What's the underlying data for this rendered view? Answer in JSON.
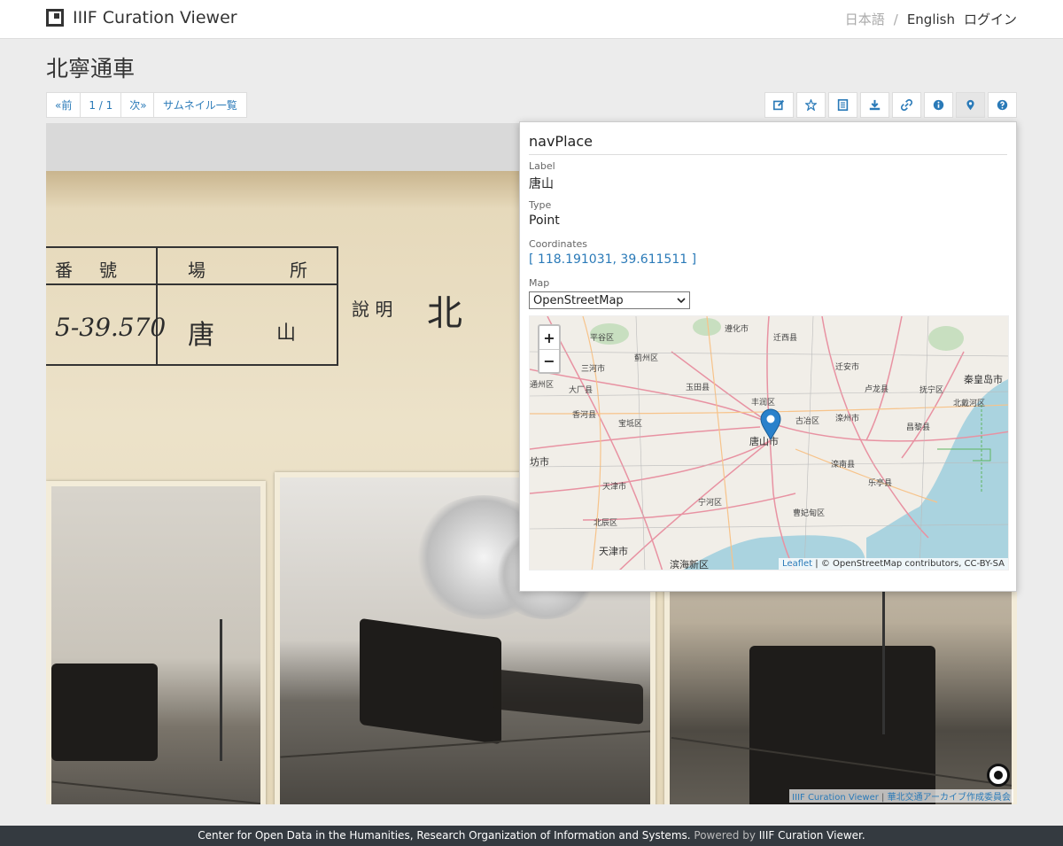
{
  "app": {
    "brand": "IIIF Curation Viewer",
    "lang_ja": "日本語",
    "lang_sep": "/",
    "lang_en": "English",
    "login": "ログイン"
  },
  "page": {
    "title": "北寧通車"
  },
  "pager": {
    "prev": "«前",
    "position": "1 / 1",
    "next": "次»",
    "thumbnails": "サムネイル一覧"
  },
  "toolbar": {
    "icons": [
      "edit-icon",
      "star-icon",
      "list-icon",
      "download-icon",
      "link-icon",
      "info-icon",
      "map-marker-icon",
      "help-icon"
    ],
    "active": "map-marker-icon"
  },
  "scan": {
    "header_cells": [
      "番",
      "號",
      "場",
      "所"
    ],
    "number": "5-39.570",
    "place": "唐",
    "place2": "山",
    "description_label": "說 明",
    "description_text": "北",
    "attribution_link": "IIIF Curation Viewer",
    "attribution_sep": "|",
    "attribution_owner": "華北交通アーカイブ作成委員会"
  },
  "navplace": {
    "title": "navPlace",
    "label_key": "Label",
    "label_value": "唐山",
    "type_key": "Type",
    "type_value": "Point",
    "coordinates_key": "Coordinates",
    "coordinates_value": "[ 118.191031, 39.611511 ]",
    "map_key": "Map",
    "map_selected": "OpenStreetMap",
    "zoom_in": "+",
    "zoom_out": "−",
    "map_attr_link": "Leaflet",
    "map_attr_text": " | © OpenStreetMap contributors, CC-BY-SA",
    "cities": [
      "平谷区",
      "遵化市",
      "迁西县",
      "三河市",
      "蓟州区",
      "迁安市",
      "秦皇岛市",
      "通州区",
      "大厂县",
      "玉田县",
      "丰润区",
      "卢龙县",
      "抚宁区",
      "香河县",
      "北戴河区",
      "宝坻区",
      "古冶区",
      "滦州市",
      "昌黎县",
      "唐山市",
      "坊市",
      "滦南县",
      "天津市",
      "宁河区",
      "乐亭县",
      "北辰区",
      "曹妃甸区",
      "天津市",
      "滨海新区"
    ]
  },
  "footer": {
    "org": "Center for Open Data in the Humanities, Research Organization of Information and Systems.",
    "powered": " Powered by ",
    "product": "IIIF Curation Viewer."
  },
  "colors": {
    "link": "#2a7ab8",
    "footer_bg": "#343a40",
    "marker": "#2a81cb"
  }
}
